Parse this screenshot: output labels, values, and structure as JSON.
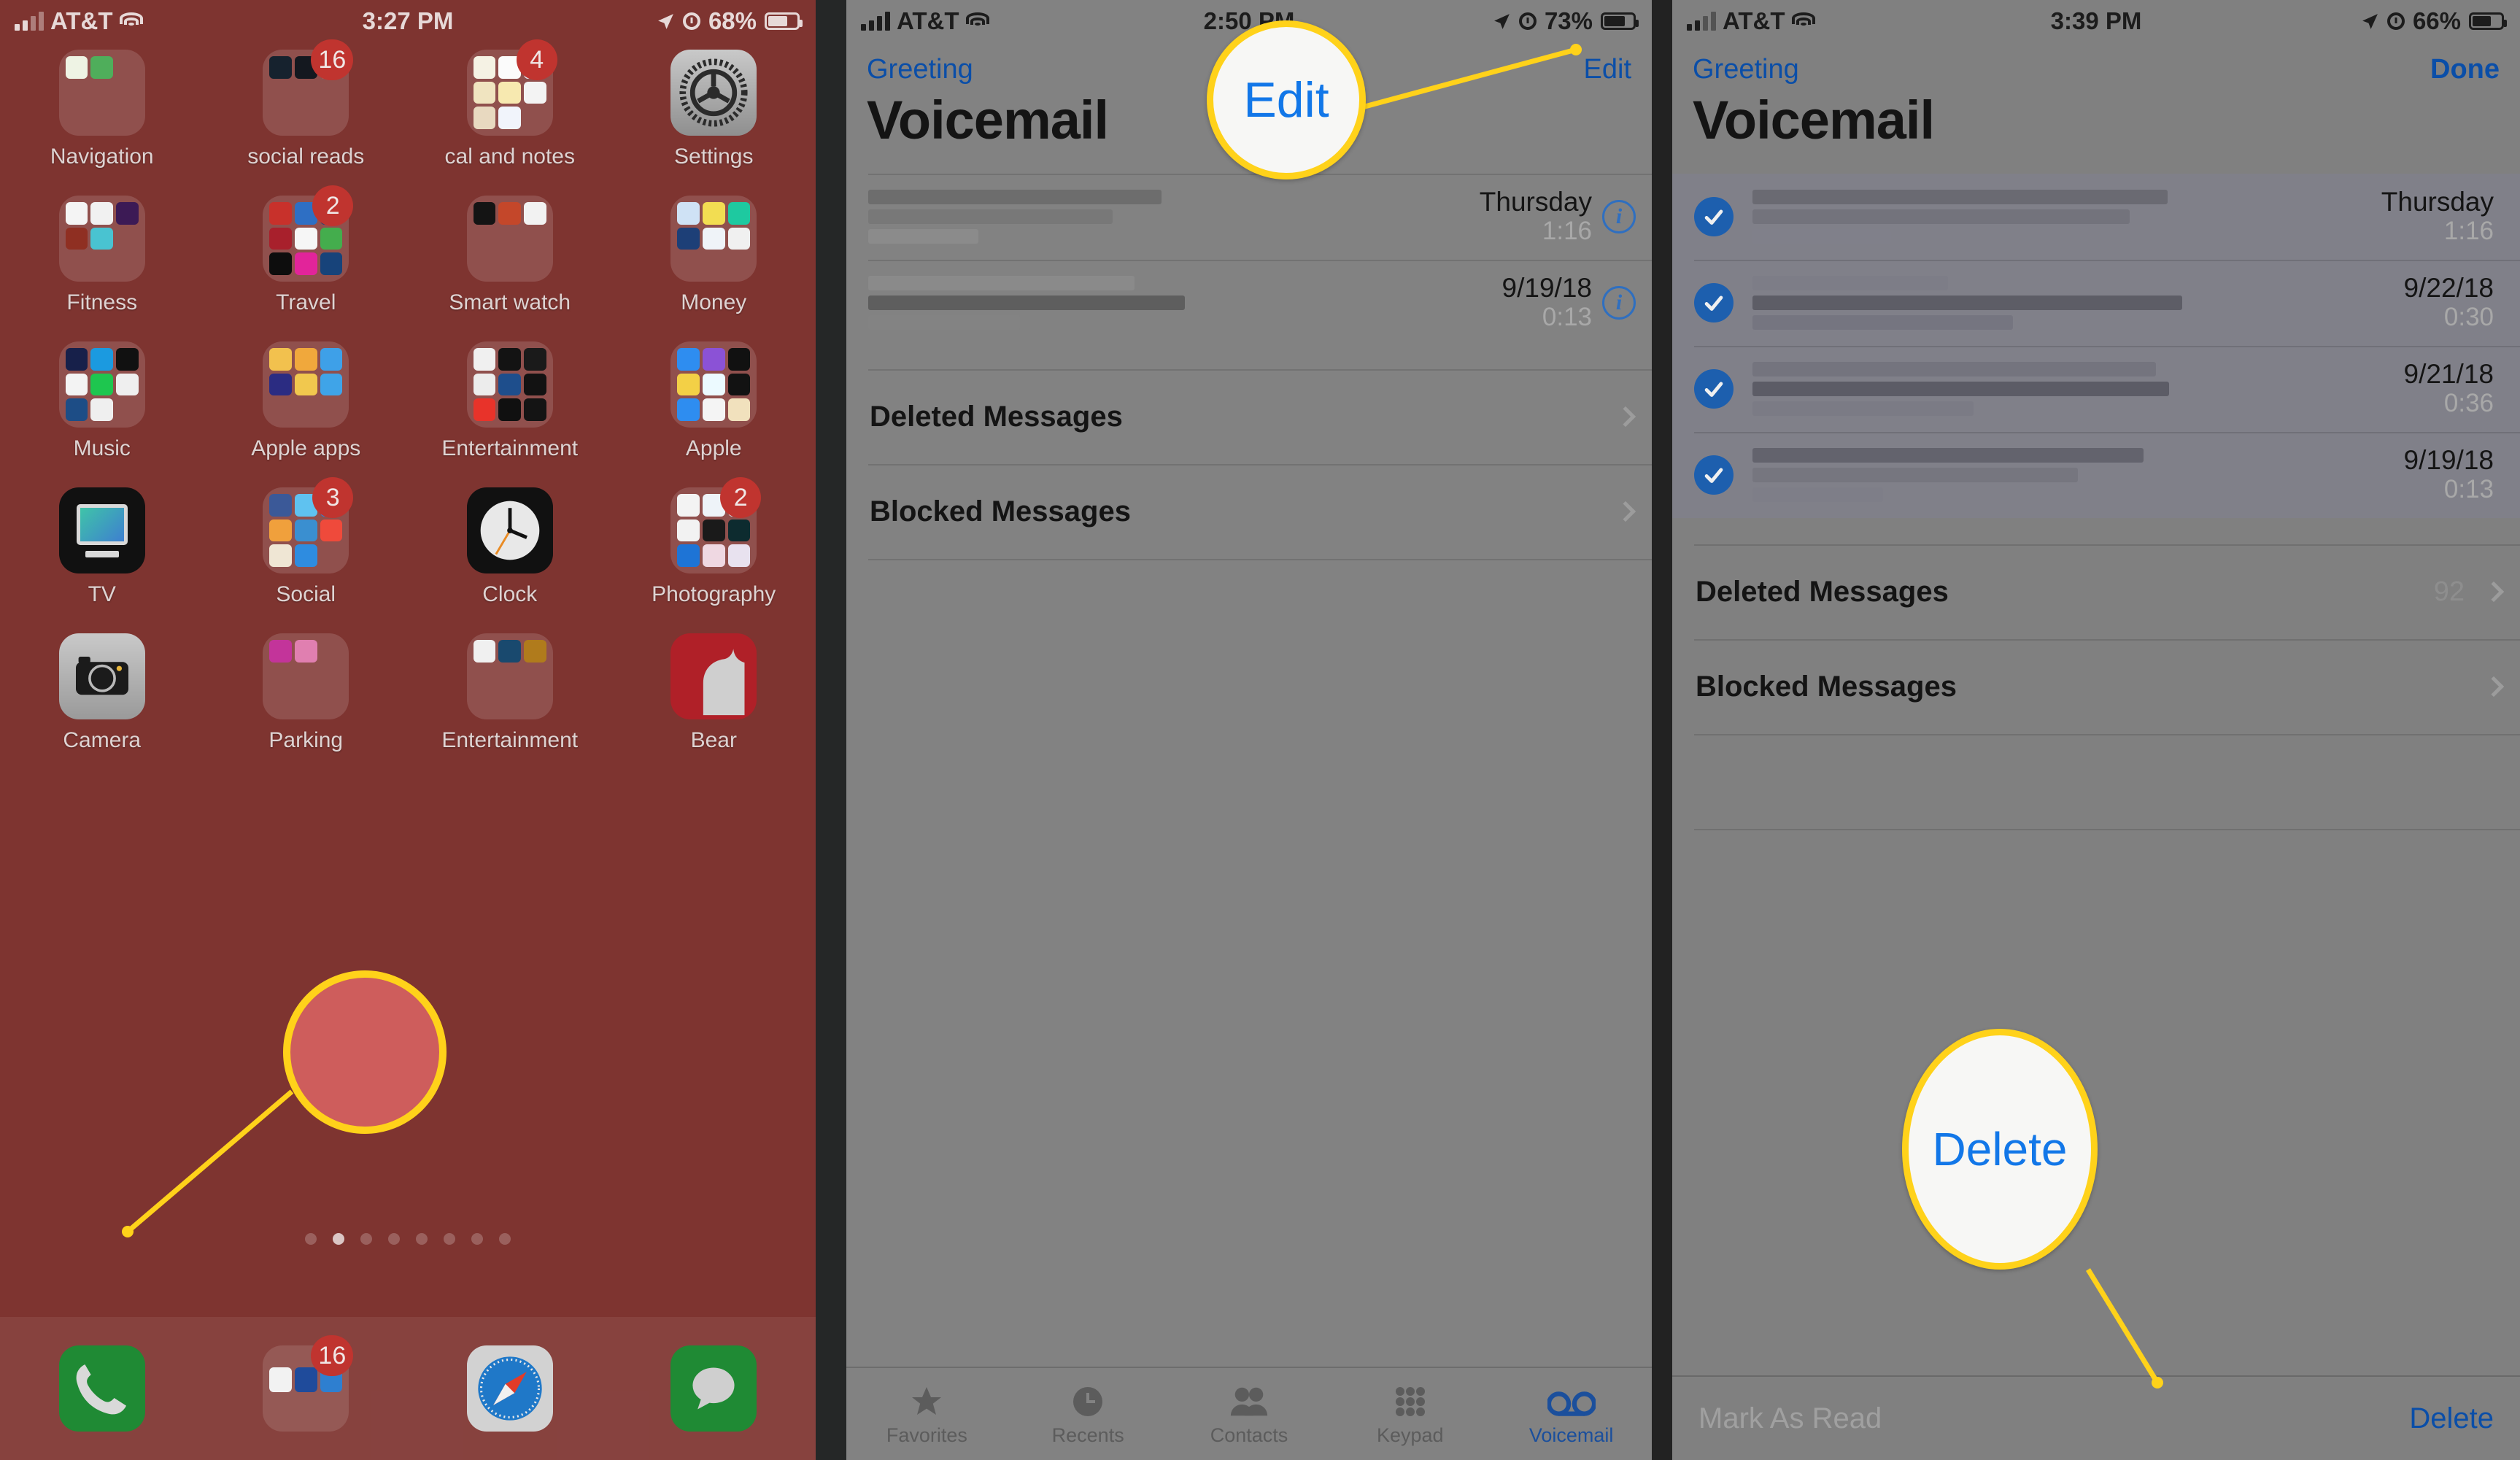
{
  "panel1": {
    "status": {
      "carrier": "AT&T",
      "time": "3:27 PM",
      "battery": "68%"
    },
    "rows": [
      [
        {
          "label": "Navigation",
          "badge": "",
          "type": "folder"
        },
        {
          "label": "social reads",
          "badge": "16",
          "type": "folder"
        },
        {
          "label": "cal and notes",
          "badge": "4",
          "type": "folder"
        },
        {
          "label": "Settings",
          "badge": "",
          "type": "icon",
          "icon": "gear-icon"
        }
      ],
      [
        {
          "label": "Fitness",
          "badge": "",
          "type": "folder"
        },
        {
          "label": "Travel",
          "badge": "2",
          "type": "folder"
        },
        {
          "label": "Smart watch",
          "badge": "",
          "type": "folder"
        },
        {
          "label": "Money",
          "badge": "",
          "type": "folder"
        }
      ],
      [
        {
          "label": "Music",
          "badge": "",
          "type": "folder"
        },
        {
          "label": "Apple apps",
          "badge": "",
          "type": "folder"
        },
        {
          "label": "Entertainment",
          "badge": "",
          "type": "folder"
        },
        {
          "label": "Apple",
          "badge": "",
          "type": "folder"
        }
      ],
      [
        {
          "label": "TV",
          "badge": "",
          "type": "icon",
          "icon": "tv-icon"
        },
        {
          "label": "Social",
          "badge": "3",
          "type": "folder"
        },
        {
          "label": "Clock",
          "badge": "",
          "type": "icon",
          "icon": "clock-icon"
        },
        {
          "label": "Photography",
          "badge": "2",
          "type": "folder"
        }
      ],
      [
        {
          "label": "Camera",
          "badge": "",
          "type": "icon",
          "icon": "camera-icon"
        },
        {
          "label": "Parking",
          "badge": "",
          "type": "folder"
        },
        {
          "label": "Entertainment",
          "badge": "",
          "type": "folder"
        },
        {
          "label": "Bear",
          "badge": "",
          "type": "icon",
          "icon": "bear-icon"
        }
      ]
    ],
    "page_dots": {
      "count": 8,
      "active_index": 1
    },
    "dock": [
      {
        "name": "phone-app-icon",
        "badge": ""
      },
      {
        "name": "mail-folder",
        "badge": "16"
      },
      {
        "name": "safari-app-icon",
        "badge": ""
      },
      {
        "name": "messages-app-icon",
        "badge": ""
      }
    ],
    "callout": {
      "target": "phone-app-icon"
    }
  },
  "panel2": {
    "status": {
      "carrier": "AT&T",
      "time": "2:50 PM",
      "battery": "73%"
    },
    "nav": {
      "back_label": "Greeting",
      "action_label": "Edit"
    },
    "title": "Voicemail",
    "voicemails": [
      {
        "date": "Thursday",
        "duration": "1:16"
      },
      {
        "date": "9/19/18",
        "duration": "0:13"
      }
    ],
    "sections": [
      {
        "label": "Deleted Messages",
        "count": ""
      },
      {
        "label": "Blocked Messages",
        "count": ""
      }
    ],
    "tabs": [
      {
        "label": "Favorites",
        "icon": "star-icon",
        "active": false
      },
      {
        "label": "Recents",
        "icon": "clock-icon",
        "active": false
      },
      {
        "label": "Contacts",
        "icon": "people-icon",
        "active": false
      },
      {
        "label": "Keypad",
        "icon": "keypad-icon",
        "active": false
      },
      {
        "label": "Voicemail",
        "icon": "voicemail-icon",
        "active": true
      }
    ],
    "callout": {
      "text": "Edit"
    }
  },
  "panel3": {
    "status": {
      "carrier": "AT&T",
      "time": "3:39 PM",
      "battery": "66%"
    },
    "nav": {
      "back_label": "Greeting",
      "action_label": "Done"
    },
    "title": "Voicemail",
    "voicemails": [
      {
        "date": "Thursday",
        "duration": "1:16",
        "selected": true
      },
      {
        "date": "9/22/18",
        "duration": "0:30",
        "selected": true
      },
      {
        "date": "9/21/18",
        "duration": "0:36",
        "selected": true
      },
      {
        "date": "9/19/18",
        "duration": "0:13",
        "selected": true
      }
    ],
    "sections": [
      {
        "label": "Deleted Messages",
        "count": "92"
      },
      {
        "label": "Blocked Messages",
        "count": ""
      }
    ],
    "bottom": {
      "mark_label": "Mark As Read",
      "delete_label": "Delete"
    },
    "callout": {
      "text": "Delete"
    }
  },
  "colors": {
    "ios_blue": "#0a4ea8",
    "check_blue": "#1d5fae",
    "callout_ring": "#ffd21a",
    "badge_red": "#c0342f",
    "wallpaper_red": "#7e3430"
  }
}
